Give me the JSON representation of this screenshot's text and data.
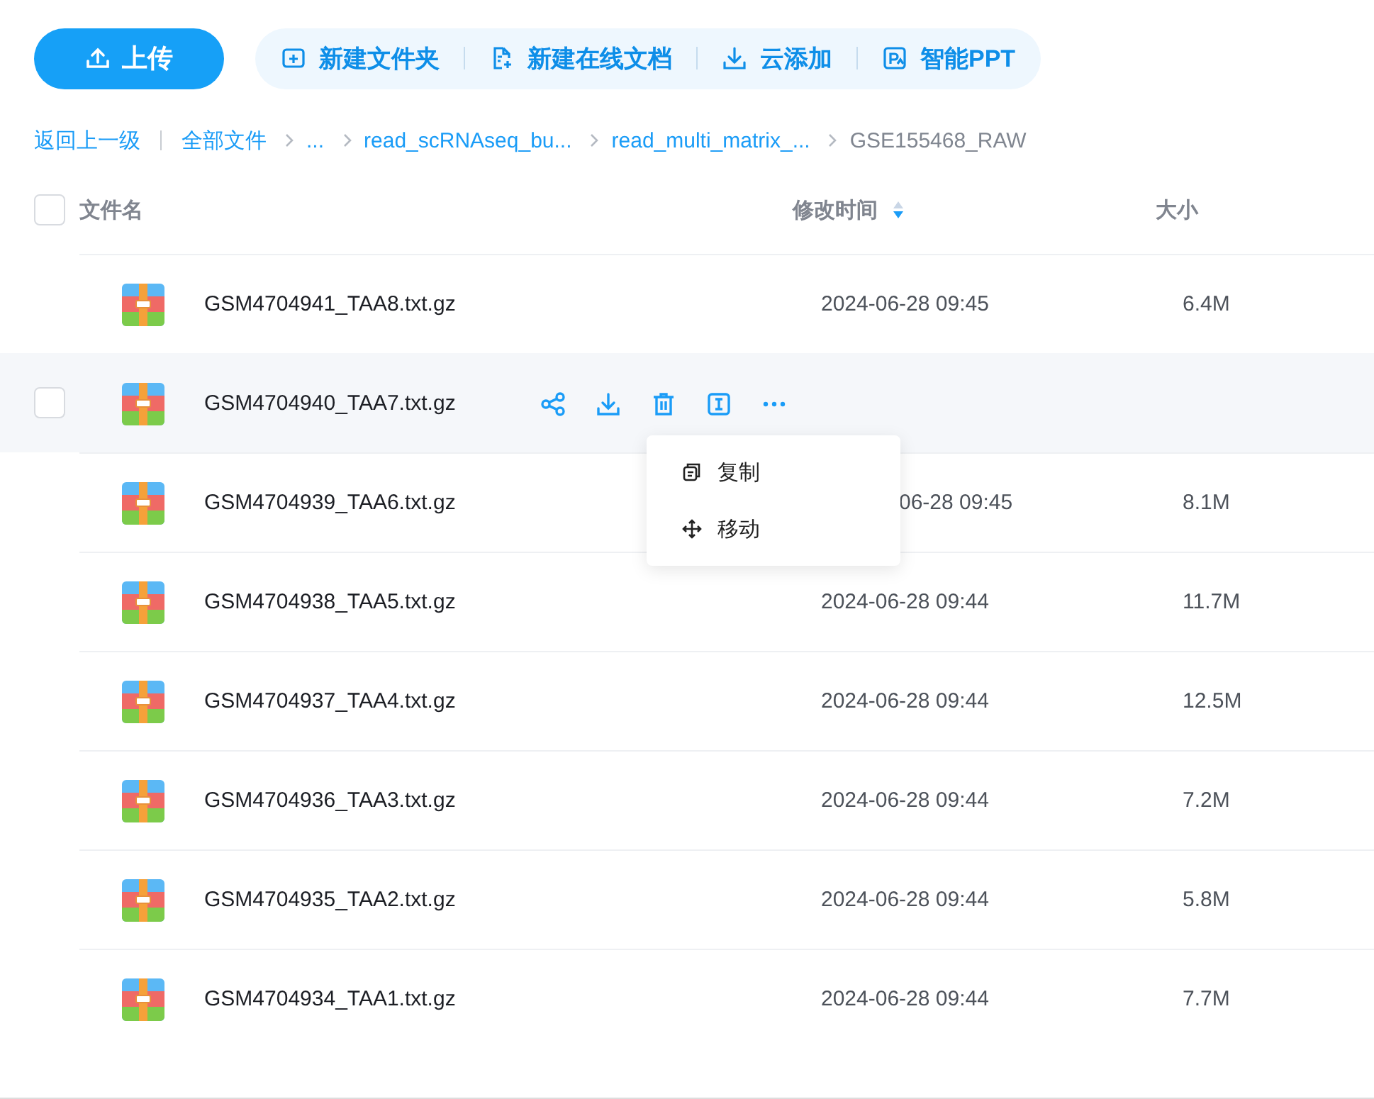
{
  "toolbar": {
    "upload": "上传",
    "actions": [
      {
        "kind": "folder",
        "label": "新建文件夹"
      },
      {
        "kind": "doc",
        "label": "新建在线文档"
      },
      {
        "kind": "download",
        "label": "云添加"
      },
      {
        "kind": "ppt",
        "label": "智能PPT"
      }
    ]
  },
  "breadcrumb": {
    "back": "返回上一级",
    "items": [
      {
        "label": "全部文件",
        "current": false
      },
      {
        "label": "...",
        "current": false
      },
      {
        "label": "read_scRNAseq_bu...",
        "current": false
      },
      {
        "label": "read_multi_matrix_...",
        "current": false
      },
      {
        "label": "GSE155468_RAW",
        "current": true
      }
    ]
  },
  "table": {
    "select_all": {
      "checked": false
    },
    "columns": [
      {
        "label": "文件名"
      },
      {
        "label": "修改时间",
        "sortable": true
      },
      {
        "label": "大小"
      }
    ],
    "rows": [
      {
        "name": "GSM4704941_TAA8.txt.gz",
        "date": "2024-06-28 09:45",
        "size": "6.4M",
        "hovered": false
      },
      {
        "name": "GSM4704940_TAA7.txt.gz",
        "hovered": true,
        "checked": false
      },
      {
        "name": "GSM4704939_TAA6.txt.gz",
        "date": "06-28 09:45",
        "size": "8.1M",
        "hovered": false
      },
      {
        "name": "GSM4704938_TAA5.txt.gz",
        "date": "2024-06-28 09:44",
        "size": "11.7M",
        "hovered": false
      },
      {
        "name": "GSM4704937_TAA4.txt.gz",
        "date": "2024-06-28 09:44",
        "size": "12.5M",
        "hovered": false
      },
      {
        "name": "GSM4704936_TAA3.txt.gz",
        "date": "2024-06-28 09:44",
        "size": "7.2M",
        "hovered": false
      },
      {
        "name": "GSM4704935_TAA2.txt.gz",
        "date": "2024-06-28 09:44",
        "size": "5.8M",
        "hovered": false
      },
      {
        "name": "GSM4704934_TAA1.txt.gz",
        "date": "2024-06-28 09:44",
        "size": "7.7M",
        "hovered": false
      }
    ]
  },
  "context_menu": [
    {
      "kind": "copy",
      "label": "复制"
    },
    {
      "kind": "move",
      "label": "移动"
    }
  ]
}
